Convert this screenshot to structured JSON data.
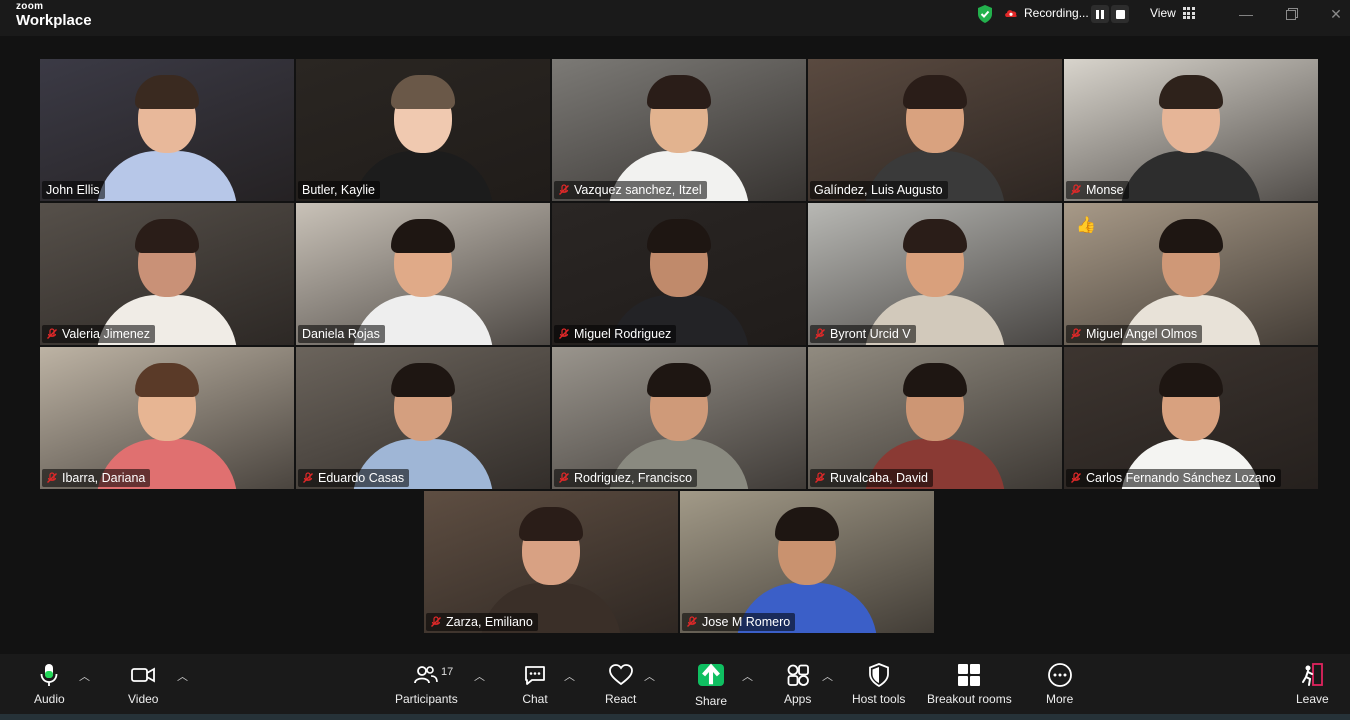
{
  "window": {
    "brand_small": "zoom",
    "brand_large": "Workplace",
    "recording_label": "Recording...",
    "view_label": "View",
    "window_controls": [
      "minimize-icon",
      "maximize-icon",
      "close-icon"
    ]
  },
  "participants": [
    {
      "name": "John Ellis",
      "muted": false,
      "active": false,
      "reaction": ""
    },
    {
      "name": "Butler, Kaylie",
      "muted": false,
      "active": true,
      "reaction": ""
    },
    {
      "name": "Vazquez sanchez, Itzel",
      "muted": true,
      "active": false,
      "reaction": ""
    },
    {
      "name": "Galíndez, Luis Augusto",
      "muted": false,
      "active": false,
      "reaction": ""
    },
    {
      "name": "Monse",
      "muted": true,
      "active": false,
      "reaction": ""
    },
    {
      "name": "Valeria Jimenez",
      "muted": true,
      "active": false,
      "reaction": ""
    },
    {
      "name": "Daniela Rojas",
      "muted": false,
      "active": false,
      "reaction": ""
    },
    {
      "name": "Miguel Rodriguez",
      "muted": true,
      "active": false,
      "reaction": ""
    },
    {
      "name": "Byront Urcid V",
      "muted": true,
      "active": false,
      "reaction": ""
    },
    {
      "name": "Miguel Angel Olmos",
      "muted": true,
      "active": false,
      "reaction": "👍"
    },
    {
      "name": "Ibarra, Dariana",
      "muted": true,
      "active": false,
      "reaction": ""
    },
    {
      "name": "Eduardo Casas",
      "muted": true,
      "active": false,
      "reaction": ""
    },
    {
      "name": "Rodriguez, Francisco",
      "muted": true,
      "active": false,
      "reaction": ""
    },
    {
      "name": "Ruvalcaba, David",
      "muted": true,
      "active": false,
      "reaction": ""
    },
    {
      "name": "Carlos Fernando Sánchez Lozano",
      "muted": true,
      "active": false,
      "reaction": ""
    },
    {
      "name": "Zarza, Emiliano",
      "muted": true,
      "active": false,
      "reaction": ""
    },
    {
      "name": "Jose M Romero",
      "muted": true,
      "active": false,
      "reaction": ""
    }
  ],
  "toolbar": {
    "audio": "Audio",
    "video": "Video",
    "participants": "Participants",
    "participant_count": "17",
    "chat": "Chat",
    "react": "React",
    "share": "Share",
    "apps": "Apps",
    "host_tools": "Host tools",
    "breakout_rooms": "Breakout rooms",
    "more": "More",
    "leave": "Leave"
  },
  "colors": {
    "active_speaker": "#23d959",
    "share_green": "#0fbf61",
    "mute_red": "#e02828",
    "leave_red": "#e0245e"
  }
}
